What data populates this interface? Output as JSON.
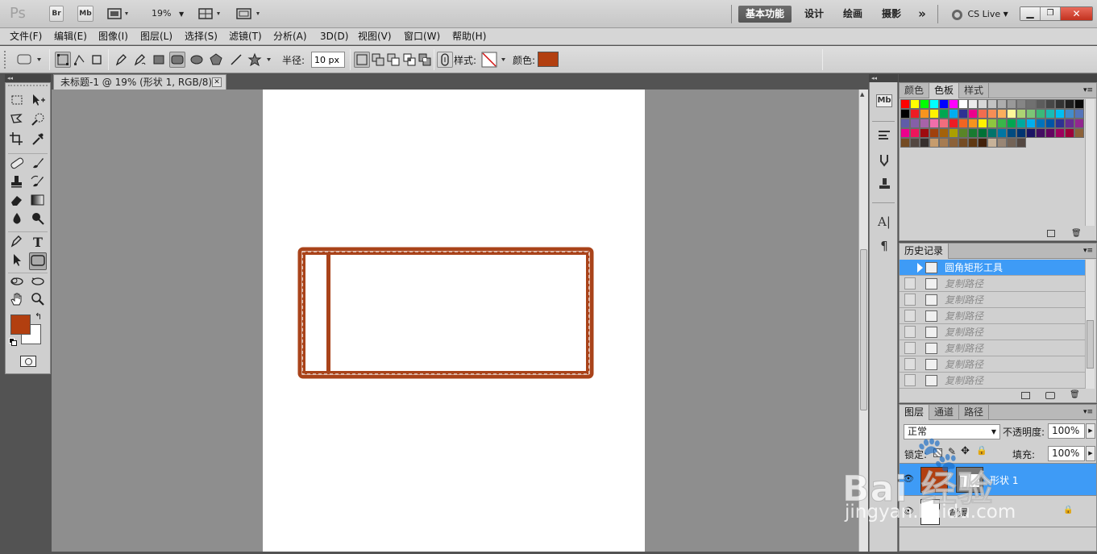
{
  "appbar": {
    "logo": "Ps",
    "br": "Br",
    "mb": "Mb",
    "zoom": "19%",
    "workspaces": [
      "基本功能",
      "设计",
      "绘画",
      "摄影"
    ],
    "more": "»",
    "cslive": "CS Live"
  },
  "menu": [
    "文件(F)",
    "编辑(E)",
    "图像(I)",
    "图层(L)",
    "选择(S)",
    "滤镜(T)",
    "分析(A)",
    "3D(D)",
    "视图(V)",
    "窗口(W)",
    "帮助(H)"
  ],
  "options": {
    "radius_label": "半径:",
    "radius_value": "10 px",
    "style_label": "样式:",
    "color_label": "颜色:",
    "color": "#b23f10"
  },
  "document": {
    "tab_title": "未标题-1 @ 19% (形状 1, RGB/8) *",
    "shape_color": "#a9431a"
  },
  "swatches_panel": {
    "tabs": [
      "颜色",
      "色板",
      "样式"
    ],
    "active": "色板"
  },
  "history_panel": {
    "tab": "历史记录",
    "items": [
      "圆角矩形工具",
      "复制路径",
      "复制路径",
      "复制路径",
      "复制路径",
      "复制路径",
      "复制路径",
      "复制路径"
    ]
  },
  "layers_panel": {
    "tabs": [
      "图层",
      "通道",
      "路径"
    ],
    "blend_mode": "正常",
    "opacity_label": "不透明度:",
    "opacity": "100%",
    "lock_label": "锁定:",
    "fill_label": "填充:",
    "fill": "100%",
    "layers": [
      {
        "name": "形状 1",
        "selected": true
      },
      {
        "name": "背景",
        "selected": false
      }
    ]
  },
  "watermark": {
    "main": "Bai 经验",
    "sub": "jingyan.baidu.com"
  }
}
